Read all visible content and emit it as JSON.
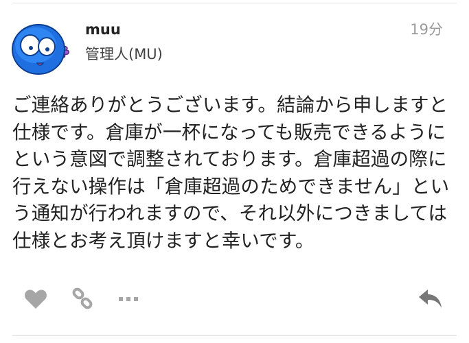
{
  "post": {
    "username": "muu",
    "user_title": "管理人(MU)",
    "timestamp": "19分",
    "body": "ご連絡ありがとうございます。結論から申しますと仕様です。倉庫が一杯になっても販売できるようにという意図で調整されております。倉庫超過の際に行えない操作は「倉庫超過のためできません」という通知が行われますので、それ以外につきましては仕様とお考え頂けますと幸いです。"
  },
  "actions": {
    "like_icon": "heart-icon",
    "link_icon": "link-icon",
    "more_icon": "ellipsis-icon",
    "reply_icon": "reply-arrow-icon"
  },
  "colors": {
    "icon_gray": "#a0a0a0",
    "reply_icon": "#777777",
    "avatar_blue": "#1f6fe0",
    "avatar_purple": "#a85bd6"
  }
}
